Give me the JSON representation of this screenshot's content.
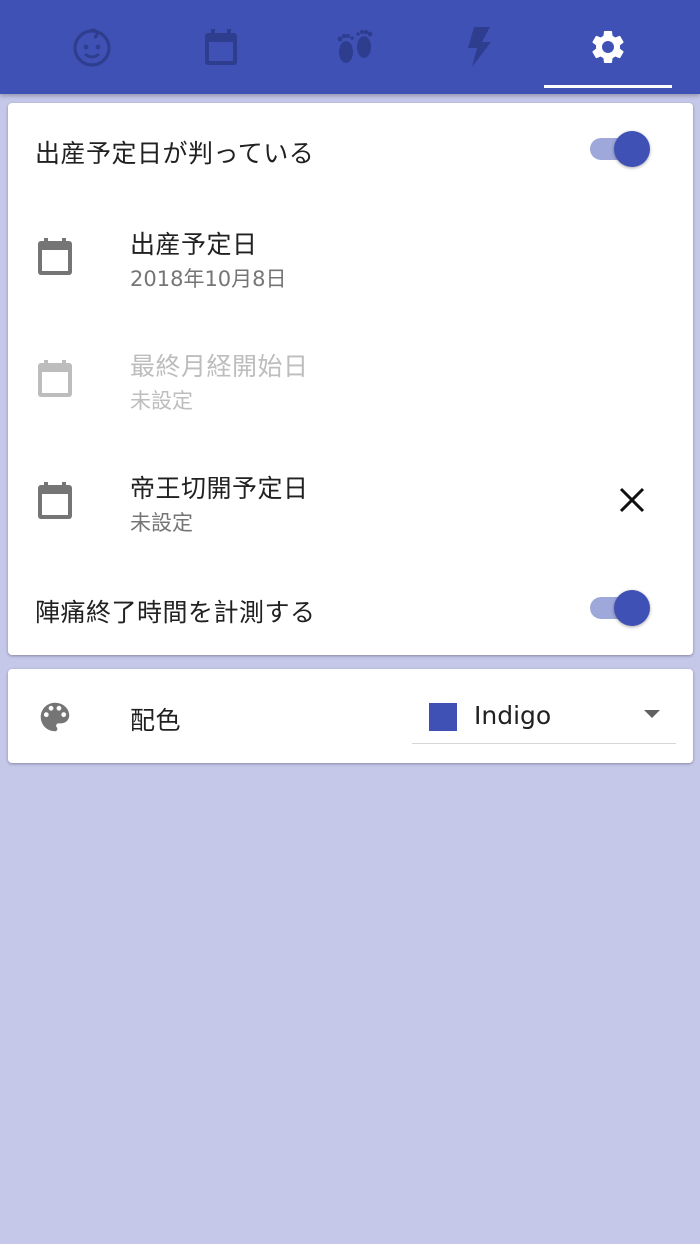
{
  "tabs": [
    {
      "icon": "baby-face-icon",
      "active": false
    },
    {
      "icon": "calendar-icon",
      "active": false
    },
    {
      "icon": "footprints-icon",
      "active": false
    },
    {
      "icon": "lightning-icon",
      "active": false
    },
    {
      "icon": "gear-icon",
      "active": true
    }
  ],
  "settings": {
    "due_date_known_label": "出産予定日が判っている",
    "due_date_known_on": true,
    "due_date": {
      "label": "出産予定日",
      "value": "2018年10月8日",
      "icon": "calendar-icon"
    },
    "last_period": {
      "label": "最終月経開始日",
      "value": "未設定",
      "icon": "calendar-icon",
      "disabled": true
    },
    "cesarean": {
      "label": "帝王切開予定日",
      "value": "未設定",
      "icon": "calendar-icon",
      "clear_icon": "close-icon"
    },
    "measure_end_label": "陣痛終了時間を計測する",
    "measure_end_on": true
  },
  "theme": {
    "label": "配色",
    "icon": "palette-icon",
    "selected": "Indigo",
    "swatch_color": "#3f51b5"
  },
  "colors": {
    "primary": "#3f51b5",
    "background": "#c5c8e9",
    "inactive_tab_icon": "#2f3d8f",
    "active_tab_icon": "#ffffff"
  }
}
